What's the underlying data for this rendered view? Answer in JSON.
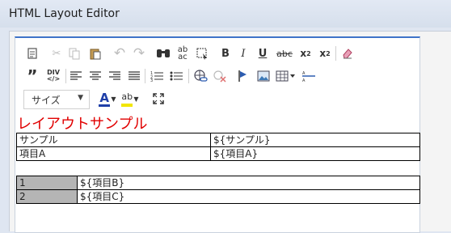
{
  "window": {
    "title": "HTML Layout Editor"
  },
  "toolbar": {
    "row1": [
      {
        "name": "paste-from-word-icon",
        "glyph": "📋"
      },
      {
        "name": "cut-icon",
        "glyph": "✂"
      },
      {
        "name": "copy-icon",
        "glyph": "⧉"
      },
      {
        "name": "paste-icon",
        "glyph": "📋"
      },
      {
        "name": "undo-icon",
        "glyph": "↶"
      },
      {
        "name": "redo-icon",
        "glyph": "↷"
      },
      {
        "name": "find-icon",
        "glyph": "🔍"
      },
      {
        "name": "replace-icon",
        "glyph": "ab"
      },
      {
        "name": "select-all-icon",
        "glyph": "⬚"
      },
      {
        "name": "bold-icon",
        "glyph": "B"
      },
      {
        "name": "italic-icon",
        "glyph": "I"
      },
      {
        "name": "underline-icon",
        "glyph": "U"
      },
      {
        "name": "strikethrough-icon",
        "glyph": "abc"
      },
      {
        "name": "subscript-icon",
        "glyph": "x₂"
      },
      {
        "name": "superscript-icon",
        "glyph": "x²"
      },
      {
        "name": "remove-format-icon",
        "glyph": "⌫"
      }
    ],
    "row2": [
      {
        "name": "blockquote-icon",
        "glyph": "❞"
      },
      {
        "name": "div-icon",
        "glyph": "DIV"
      },
      {
        "name": "align-left-icon",
        "glyph": "≡"
      },
      {
        "name": "align-center-icon",
        "glyph": "≡"
      },
      {
        "name": "align-right-icon",
        "glyph": "≡"
      },
      {
        "name": "align-justify-icon",
        "glyph": "≡"
      },
      {
        "name": "numbered-list-icon",
        "glyph": "⒈"
      },
      {
        "name": "bulleted-list-icon",
        "glyph": "•"
      },
      {
        "name": "link-icon",
        "glyph": "🔗"
      },
      {
        "name": "unlink-icon",
        "glyph": "⛓"
      },
      {
        "name": "anchor-icon",
        "glyph": "⚑"
      },
      {
        "name": "image-icon",
        "glyph": "🖼"
      },
      {
        "name": "table-icon",
        "glyph": "▦"
      },
      {
        "name": "horizontal-rule-icon",
        "glyph": "☰"
      }
    ],
    "size_select": {
      "value": "サイズ"
    },
    "text_color": {
      "glyph": "A",
      "color": "#1f3fa8"
    },
    "bg_color": {
      "glyph": "ab",
      "color": "#f2e600"
    },
    "maximize": {
      "glyph": "⤢"
    }
  },
  "content": {
    "heading": "レイアウトサンプル",
    "heading_color": "#e10000",
    "table1": [
      [
        "サンプル",
        "${サンプル}"
      ],
      [
        "項目A",
        "${項目A}"
      ]
    ],
    "table2": [
      [
        "1",
        "${項目B}"
      ],
      [
        "2",
        "${項目C}"
      ]
    ]
  }
}
